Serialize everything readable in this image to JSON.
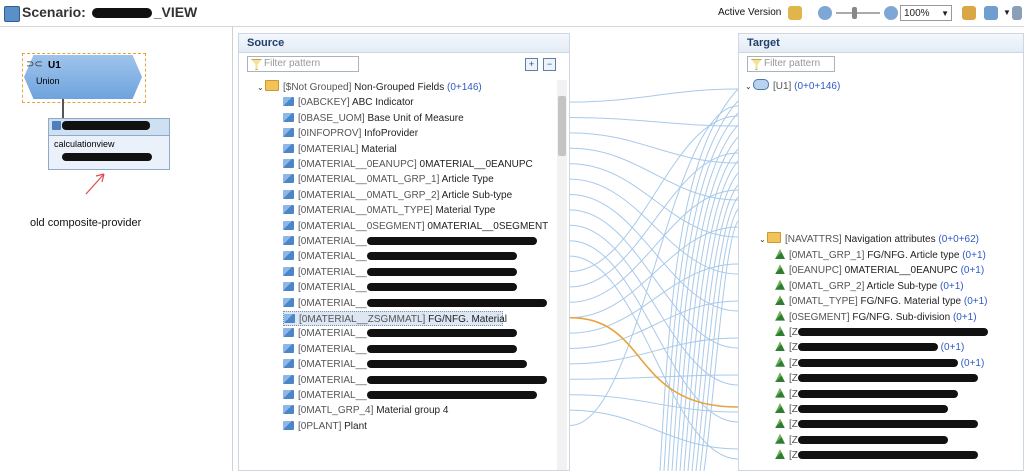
{
  "title": {
    "prefix": "Scenario:",
    "suffix": "_VIEW"
  },
  "toolbar": {
    "active_version_label": "Active Version",
    "zoom_value": "100%"
  },
  "scenario": {
    "union_label": "U1",
    "union_sub": "Union",
    "calc_sub": "calculationview",
    "note": "old composite-provider"
  },
  "source": {
    "header": "Source",
    "filter_placeholder": "Filter pattern",
    "group": {
      "tech": "[$Not Grouped]",
      "label": "Non-Grouped Fields",
      "count": "(0+146)"
    },
    "rows": [
      {
        "tech": "[0ABCKEY]",
        "label": "ABC Indicator"
      },
      {
        "tech": "[0BASE_UOM]",
        "label": "Base Unit of Measure"
      },
      {
        "tech": "[0INFOPROV]",
        "label": "InfoProvider"
      },
      {
        "tech": "[0MATERIAL]",
        "label": "Material"
      },
      {
        "tech": "[0MATERIAL__0EANUPC]",
        "label": "0MATERIAL__0EANUPC"
      },
      {
        "tech": "[0MATERIAL__0MATL_GRP_1]",
        "label": "Article Type"
      },
      {
        "tech": "[0MATERIAL__0MATL_GRP_2]",
        "label": "Article Sub-type"
      },
      {
        "tech": "[0MATERIAL__0MATL_TYPE]",
        "label": "Material Type"
      },
      {
        "tech": "[0MATERIAL__0SEGMENT]",
        "label": "0MATERIAL__0SEGMENT"
      },
      {
        "tech": "[0MATERIAL__",
        "label": ""
      },
      {
        "tech": "[0MATERIAL__",
        "label": ""
      },
      {
        "tech": "[0MATERIAL__",
        "label": ""
      },
      {
        "tech": "[0MATERIAL__",
        "label": ""
      },
      {
        "tech": "[0MATERIAL__",
        "label": ""
      },
      {
        "tech": "[0MATERIAL__ZSGMMATL]",
        "label": "FG/NFG. Material"
      },
      {
        "tech": "[0MATERIAL__",
        "label": ""
      },
      {
        "tech": "[0MATERIAL__",
        "label": ""
      },
      {
        "tech": "[0MATERIAL__",
        "label": ""
      },
      {
        "tech": "[0MATERIAL__",
        "label": ""
      },
      {
        "tech": "[0MATERIAL__",
        "label": ""
      },
      {
        "tech": "[0MATL_GRP_4]",
        "label": "Material group 4"
      },
      {
        "tech": "[0PLANT]",
        "label": "Plant"
      }
    ]
  },
  "target": {
    "header": "Target",
    "filter_placeholder": "Filter pattern",
    "root": {
      "tech": "[U1]",
      "count": "(0+0+146)"
    },
    "nav_group": {
      "tech": "[NAVATTRS]",
      "label": "Navigation attributes",
      "count": "(0+0+62)"
    },
    "rows": [
      {
        "tech": "[0MATL_GRP_1]",
        "label": "FG/NFG. Article type",
        "count": "(0+1)"
      },
      {
        "tech": "[0EANUPC]",
        "label": "0MATERIAL__0EANUPC",
        "count": "(0+1)"
      },
      {
        "tech": "[0MATL_GRP_2]",
        "label": "Article Sub-type",
        "count": "(0+1)"
      },
      {
        "tech": "[0MATL_TYPE]",
        "label": "FG/NFG. Material type",
        "count": "(0+1)"
      },
      {
        "tech": "[0SEGMENT]",
        "label": "FG/NFG. Sub-division",
        "count": "(0+1)"
      },
      {
        "tech": "[Z",
        "label": "",
        "count": ""
      },
      {
        "tech": "[Z",
        "label": "",
        "count": "(0+1)"
      },
      {
        "tech": "[Z",
        "label": "",
        "count": "(0+1)"
      },
      {
        "tech": "[Z",
        "label": "",
        "count": ""
      },
      {
        "tech": "[Z",
        "label": "",
        "count": ""
      },
      {
        "tech": "[Z",
        "label": "",
        "count": ""
      },
      {
        "tech": "[Z",
        "label": "",
        "count": ""
      },
      {
        "tech": "[Z",
        "label": "",
        "count": ""
      },
      {
        "tech": "[Z",
        "label": "",
        "count": ""
      }
    ]
  },
  "colors": {
    "link": "#a9c9ea",
    "highlight_link": "#e8a33a",
    "accent": "#2f59c4"
  }
}
